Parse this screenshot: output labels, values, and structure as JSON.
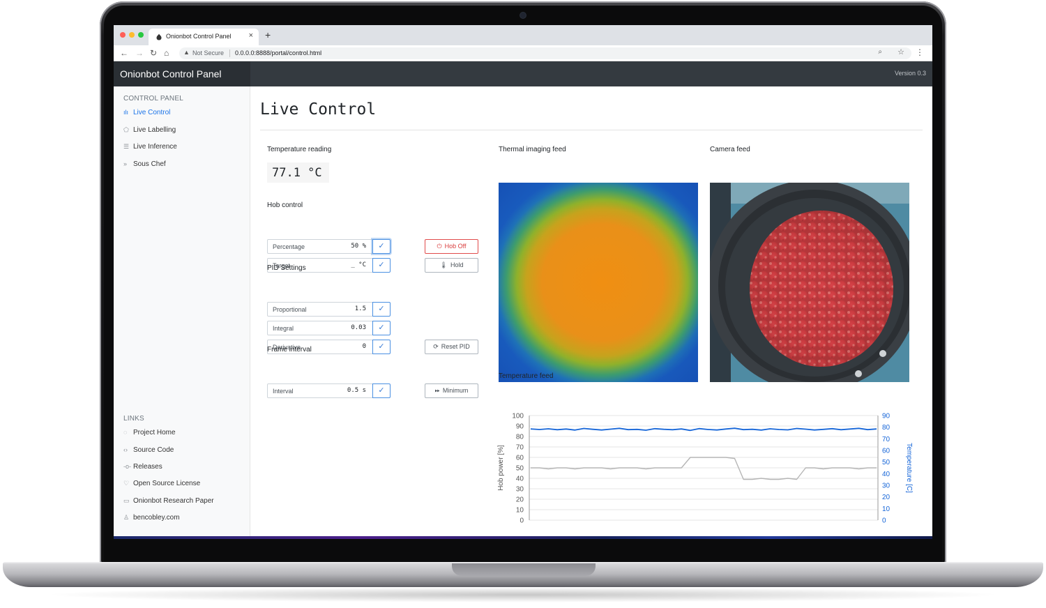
{
  "browser": {
    "tab_title": "Onionbot Control Panel",
    "tab_close": "×",
    "new_tab": "+",
    "not_secure": "Not Secure",
    "url": "0.0.0.0:8888/portal/control.html"
  },
  "app": {
    "brand": "Onionbot Control Panel",
    "version": "Version 0.3"
  },
  "sidebar": {
    "control_heading": "CONTROL PANEL",
    "control_items": [
      {
        "label": "Live Control",
        "icon": "bar-chart-icon",
        "active": true
      },
      {
        "label": "Live Labelling",
        "icon": "tag-icon",
        "active": false
      },
      {
        "label": "Live Inference",
        "icon": "database-icon",
        "active": false
      },
      {
        "label": "Sous Chef",
        "icon": "chevrons-right-icon",
        "active": false
      }
    ],
    "links_heading": "LINKS",
    "links": [
      {
        "label": "Project Home",
        "icon": "github-icon"
      },
      {
        "label": "Source Code",
        "icon": "code-icon"
      },
      {
        "label": "Releases",
        "icon": "commit-icon"
      },
      {
        "label": "Open Source License",
        "icon": "heart-icon"
      },
      {
        "label": "Onionbot Research Paper",
        "icon": "file-icon"
      },
      {
        "label": "bencobley.com",
        "icon": "user-icon"
      }
    ]
  },
  "main": {
    "title": "Live Control",
    "temperature_label": "Temperature reading",
    "temperature_value": "77.1 °C",
    "hob_label": "Hob control",
    "percentage_label": "Percentage",
    "percentage_value": "50 %",
    "target_label": "Target",
    "target_value": "_ °C",
    "hob_off_label": "Hob Off",
    "hold_label": "Hold",
    "pid_label": "PID Settings",
    "proportional_label": "Proportional",
    "proportional_value": "1.5",
    "integral_label": "Integral",
    "integral_value": "0.03",
    "derivative_label": "Derivative",
    "derivative_value": "0",
    "reset_pid_label": "Reset PID",
    "frame_label": "Frame interval",
    "interval_label": "Interval",
    "interval_value": "0.5 s",
    "minimum_label": "Minimum",
    "thermal_label": "Thermal imaging feed",
    "camera_label": "Camera feed",
    "chart_label": "Temperature feed",
    "check_glyph": "✓"
  },
  "colors": {
    "accent": "#1a73e8",
    "danger": "#d93b3b",
    "appbar": "#343a40",
    "temperature_series": "#1565d8",
    "hob_series": "#b5b5b5"
  },
  "chart_data": {
    "type": "line",
    "title": "Temperature feed",
    "y_left": {
      "label": "Hob power [%]",
      "ticks": [
        0,
        10,
        20,
        30,
        40,
        50,
        60,
        70,
        80,
        90,
        100
      ],
      "range": [
        0,
        100
      ]
    },
    "y_right": {
      "label": "Temperature [C]",
      "ticks": [
        0,
        10,
        20,
        30,
        40,
        50,
        60,
        70,
        80,
        90
      ],
      "range": [
        0,
        90
      ]
    },
    "series": [
      {
        "name": "Temperature",
        "axis": "right",
        "values": [
          78.5,
          78.0,
          78.6,
          77.8,
          78.4,
          77.5,
          78.9,
          78.2,
          77.6,
          78.3,
          79.0,
          77.9,
          78.1,
          77.4,
          78.7,
          78.2,
          77.8,
          78.5,
          77.2,
          78.8,
          78.0,
          77.6,
          78.4,
          79.1,
          77.9,
          78.2,
          77.5,
          78.6,
          78.0,
          77.7,
          78.9,
          78.3,
          77.6,
          78.1,
          78.7,
          77.8,
          78.4,
          79.0,
          77.9,
          78.5
        ]
      },
      {
        "name": "Hob power",
        "axis": "left",
        "values": [
          50,
          50,
          49,
          50,
          50,
          49,
          50,
          50,
          50,
          49,
          50,
          50,
          50,
          49,
          50,
          50,
          50,
          50,
          60,
          60,
          60,
          60,
          60,
          59,
          39,
          39,
          40,
          39,
          39,
          40,
          39,
          50,
          50,
          49,
          50,
          50,
          50,
          49,
          50,
          50
        ]
      }
    ]
  }
}
